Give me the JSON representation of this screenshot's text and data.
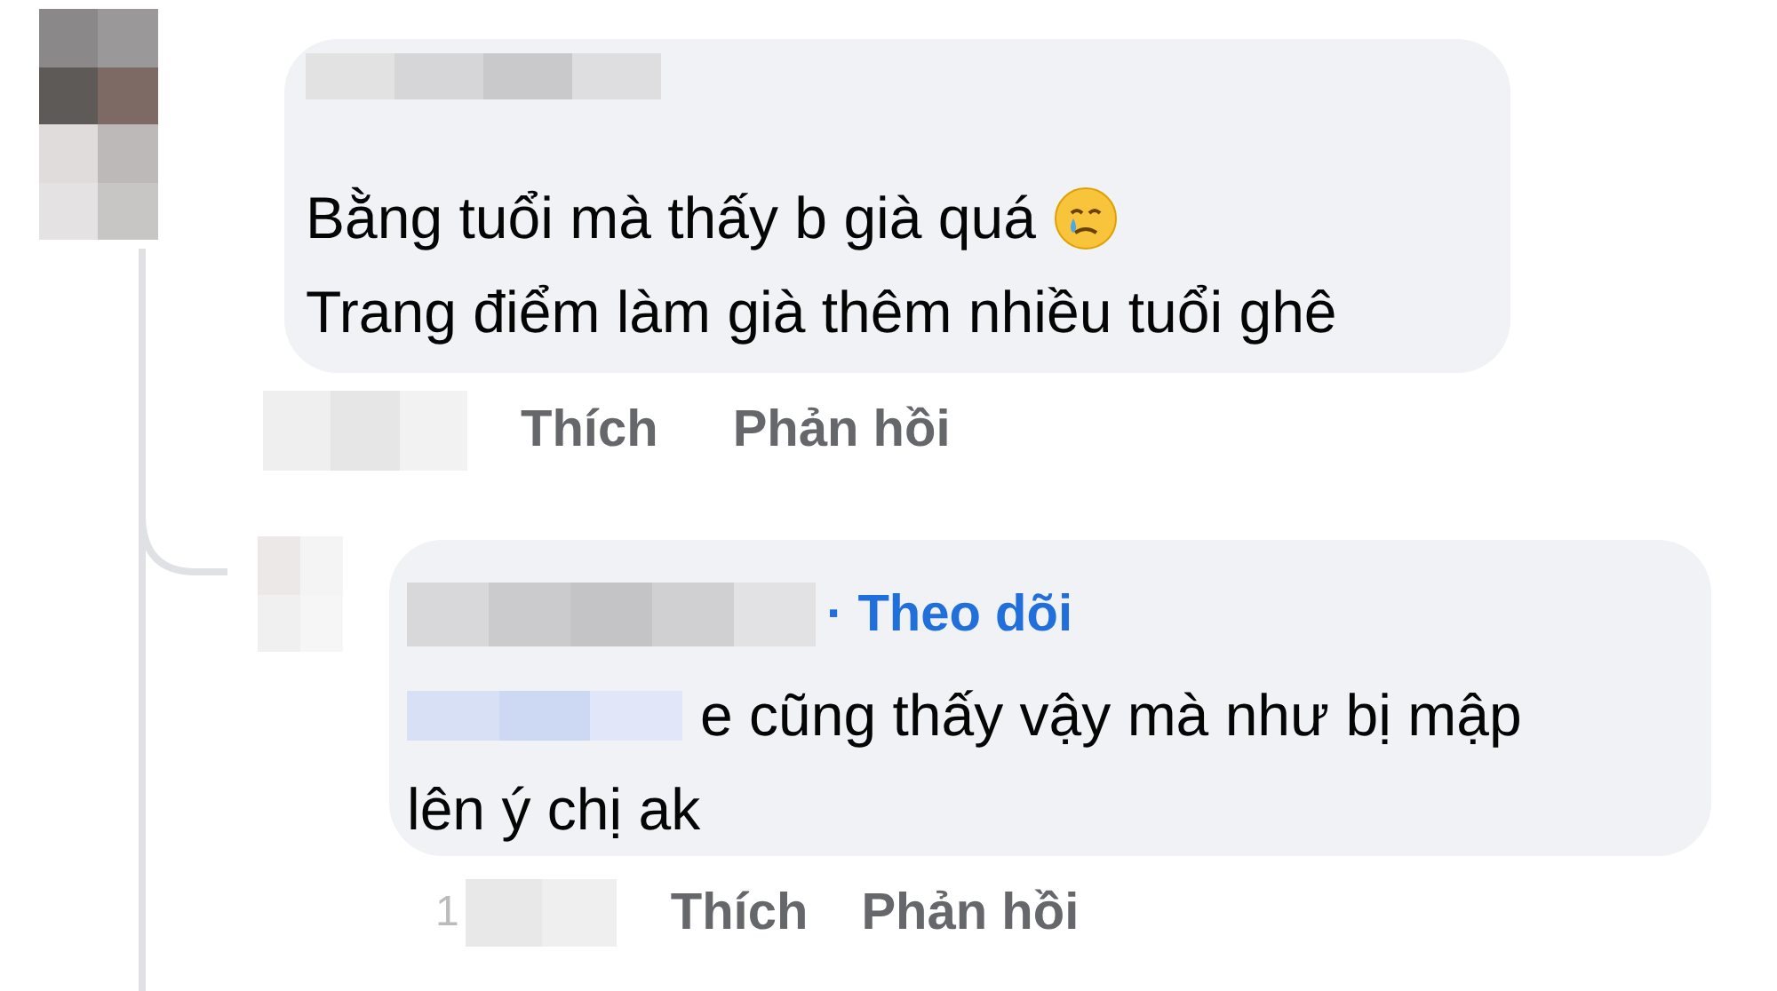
{
  "comment": {
    "text_lines": [
      "Bằng tuổi mà thấy b già quá",
      "Trang điểm làm già thêm nhiều tuổi ghê"
    ],
    "actions": [
      "Thích",
      "Phản hồi"
    ]
  },
  "reply": {
    "follow_link": "· Theo dõi",
    "text_lines": [
      "e cũng thấy vậy mà như bị mập",
      "lên ý chị ak"
    ],
    "time": "1",
    "actions": [
      "Thích",
      "Phản hồi"
    ]
  }
}
